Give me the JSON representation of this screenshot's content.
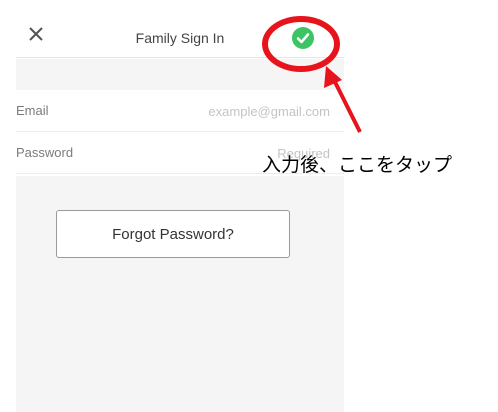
{
  "navbar": {
    "close_glyph": "✕",
    "title": "Family Sign In",
    "confirm_glyph": "✓"
  },
  "form": {
    "email_label": "Email",
    "email_placeholder": "example@gmail.com",
    "password_label": "Password",
    "password_placeholder": "Required"
  },
  "forgot_label": "Forgot Password?",
  "annotation": {
    "text": "入力後、ここをタップ",
    "color": "#e8141c"
  },
  "colors": {
    "confirm": "#3cc464",
    "background": "#f5f5f5"
  }
}
